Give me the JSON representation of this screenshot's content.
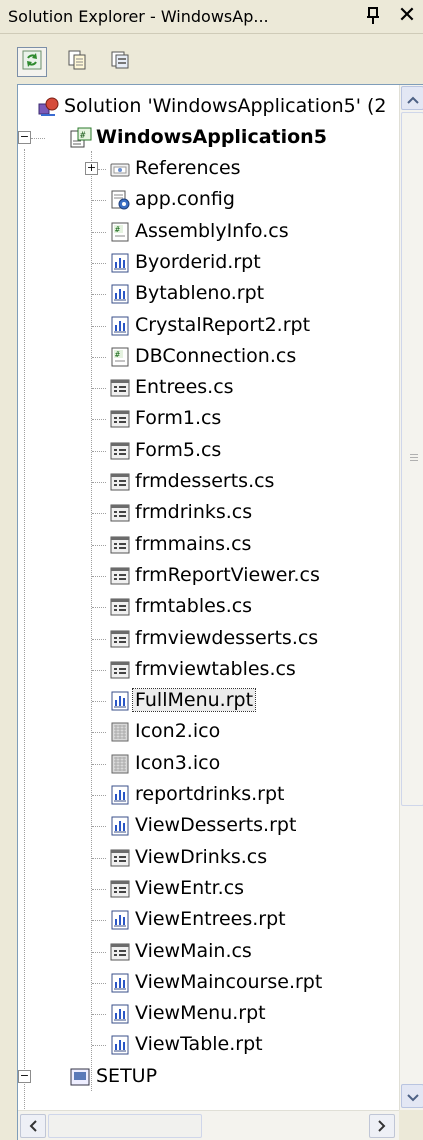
{
  "window": {
    "title": "Solution Explorer - WindowsAp...",
    "pin_icon": "pin-icon",
    "close_glyph": "✕"
  },
  "toolbar": {
    "buttons": [
      {
        "name": "refresh",
        "icon": "refresh-icon",
        "pressed": true
      },
      {
        "name": "show-all-files",
        "icon": "show-all-files-icon",
        "pressed": false
      },
      {
        "name": "properties",
        "icon": "properties-icon",
        "pressed": false
      }
    ]
  },
  "tree": {
    "solution": {
      "label": "Solution 'WindowsApplication5' (2",
      "icon": "solution-icon"
    },
    "project": {
      "label": "WindowsApplication5",
      "icon": "csharp-project-icon",
      "expanded": true
    },
    "items": [
      {
        "label": "References",
        "icon": "references-icon",
        "expandable": true
      },
      {
        "label": "app.config",
        "icon": "config-file-icon"
      },
      {
        "label": "AssemblyInfo.cs",
        "icon": "cs-code-icon"
      },
      {
        "label": "Byorderid.rpt",
        "icon": "report-icon"
      },
      {
        "label": "Bytableno.rpt",
        "icon": "report-icon"
      },
      {
        "label": "CrystalReport2.rpt",
        "icon": "report-icon"
      },
      {
        "label": "DBConnection.cs",
        "icon": "cs-code-icon"
      },
      {
        "label": "Entrees.cs",
        "icon": "form-icon"
      },
      {
        "label": "Form1.cs",
        "icon": "form-icon"
      },
      {
        "label": "Form5.cs",
        "icon": "form-icon"
      },
      {
        "label": "frmdesserts.cs",
        "icon": "form-icon"
      },
      {
        "label": "frmdrinks.cs",
        "icon": "form-icon"
      },
      {
        "label": "frmmains.cs",
        "icon": "form-icon"
      },
      {
        "label": "frmReportViewer.cs",
        "icon": "form-icon"
      },
      {
        "label": "frmtables.cs",
        "icon": "form-icon"
      },
      {
        "label": "frmviewdesserts.cs",
        "icon": "form-icon"
      },
      {
        "label": "frmviewtables.cs",
        "icon": "form-icon"
      },
      {
        "label": "FullMenu.rpt",
        "icon": "report-icon",
        "selected": true
      },
      {
        "label": "Icon2.ico",
        "icon": "ico-file-icon"
      },
      {
        "label": "Icon3.ico",
        "icon": "ico-file-icon"
      },
      {
        "label": "reportdrinks.rpt",
        "icon": "report-icon"
      },
      {
        "label": "ViewDesserts.rpt",
        "icon": "report-icon"
      },
      {
        "label": "ViewDrinks.cs",
        "icon": "form-icon"
      },
      {
        "label": "ViewEntr.cs",
        "icon": "form-icon"
      },
      {
        "label": "ViewEntrees.rpt",
        "icon": "report-icon"
      },
      {
        "label": "ViewMain.cs",
        "icon": "form-icon"
      },
      {
        "label": "ViewMaincourse.rpt",
        "icon": "report-icon"
      },
      {
        "label": "ViewMenu.rpt",
        "icon": "report-icon"
      },
      {
        "label": "ViewTable.rpt",
        "icon": "report-icon"
      }
    ],
    "setup": {
      "label": "SETUP",
      "icon": "setup-project-icon"
    }
  },
  "colors": {
    "chrome": "#ece9d8",
    "tree_bg": "#ffffff",
    "frame_border": "#7f9db9"
  }
}
